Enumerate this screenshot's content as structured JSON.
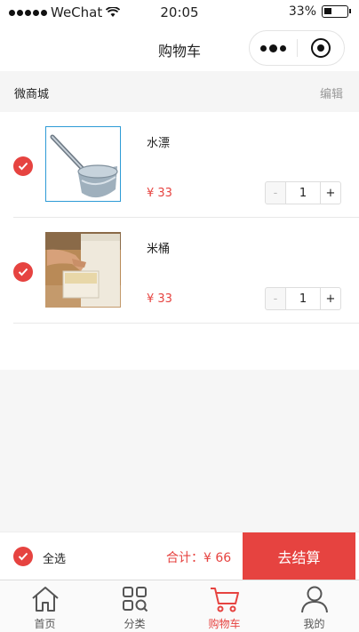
{
  "status_bar": {
    "carrier": "WeChat",
    "time": "20:05",
    "battery": "33%",
    "battery_level": 0.33
  },
  "nav": {
    "title": "购物车"
  },
  "shop": {
    "name": "微商城",
    "edit_label": "编辑"
  },
  "items": [
    {
      "name": "水漂",
      "price": "¥ 33",
      "quantity": "1",
      "minus_label": "-",
      "plus_label": "+",
      "checked": true,
      "image_icon": "ladle-image"
    },
    {
      "name": "米桶",
      "price": "¥ 33",
      "quantity": "1",
      "minus_label": "-",
      "plus_label": "+",
      "checked": true,
      "image_icon": "rice-bucket-image"
    }
  ],
  "checkout": {
    "select_all_label": "全选",
    "total_label": "合计：¥ 66",
    "button_label": "去结算"
  },
  "tabs": [
    {
      "label": "首页",
      "icon": "home-icon",
      "active": false
    },
    {
      "label": "分类",
      "icon": "category-icon",
      "active": false
    },
    {
      "label": "购物车",
      "icon": "cart-icon",
      "active": true
    },
    {
      "label": "我的",
      "icon": "profile-icon",
      "active": false
    }
  ],
  "colors": {
    "accent": "#e64340",
    "background": "#f6f6f6",
    "inactive_text": "#555555"
  }
}
